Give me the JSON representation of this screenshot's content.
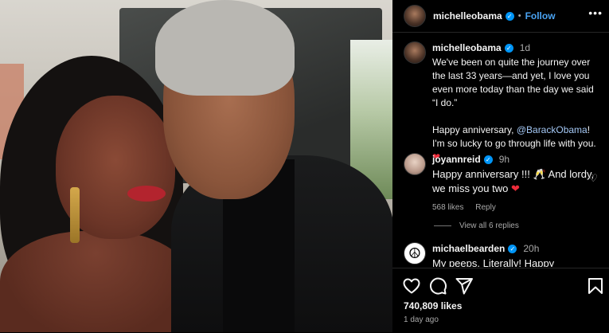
{
  "header": {
    "username": "michelleobama",
    "separator": "•",
    "follow_label": "Follow",
    "more_label": "•••"
  },
  "caption": {
    "username": "michelleobama",
    "time": "1d",
    "text_line1": "We've been on quite the journey over the last 33 years—and yet, I love you even more today than the day we said “I do.”",
    "text_line2_pre": "Happy anniversary, ",
    "mention": "@BarackObama",
    "text_line2_post": "! I'm so lucky to go through life with you. ",
    "heart": "❤"
  },
  "comments": [
    {
      "username": "joyannreid",
      "time": "9h",
      "text": "Happy anniversary !!! 🥂 And lordy, we miss you two ",
      "heart": "❤",
      "likes": "568 likes",
      "reply": "Reply",
      "view_replies": "View all 6 replies"
    },
    {
      "username": "michaelbearden",
      "time": "20h",
      "text": "My peeps. Literally! Happy"
    }
  ],
  "post": {
    "likes": "740,809 likes",
    "time_ago": "1 day ago"
  },
  "icons": {
    "verified": "✓",
    "peace": "☮",
    "heart_outline": "♡"
  }
}
